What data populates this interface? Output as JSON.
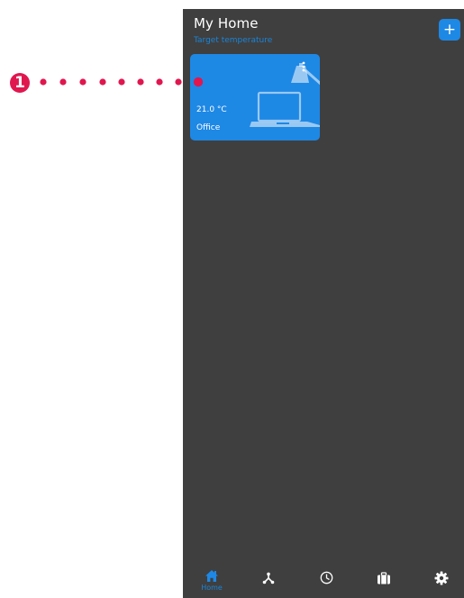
{
  "header": {
    "title": "My Home",
    "subtitle": "Target temperature",
    "add_label": "+"
  },
  "rooms": [
    {
      "name": "Office",
      "temperature": "21.0 °C",
      "icon": "laptop-icon"
    }
  ],
  "bottom_nav": {
    "items": [
      {
        "icon": "home-icon",
        "label": "Home",
        "active": true
      },
      {
        "icon": "network-icon",
        "label": ""
      },
      {
        "icon": "clock-icon",
        "label": ""
      },
      {
        "icon": "briefcase-icon",
        "label": ""
      },
      {
        "icon": "gear-icon",
        "label": ""
      }
    ]
  },
  "callout": {
    "number": "1"
  },
  "colors": {
    "accent": "#1e88e5",
    "background": "#3f3f3f",
    "callout": "#e0174f"
  }
}
